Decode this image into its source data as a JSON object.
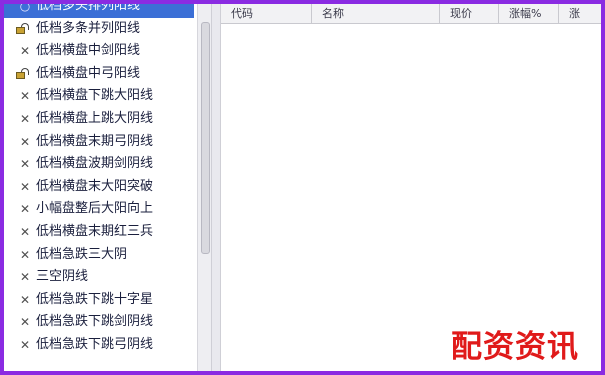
{
  "tree": {
    "items": [
      {
        "label": "低档多头排列阳线",
        "icon": "circle-icon",
        "selected": true
      },
      {
        "label": "低档多条并列阳线",
        "icon": "lock-icon"
      },
      {
        "label": "低档横盘中剑阳线",
        "icon": "x-icon"
      },
      {
        "label": "低档横盘中弓阳线",
        "icon": "lock-icon"
      },
      {
        "label": "低档横盘下跳大阳线",
        "icon": "x-icon"
      },
      {
        "label": "低档横盘上跳大阴线",
        "icon": "x-icon"
      },
      {
        "label": "低档横盘末期弓阴线",
        "icon": "x-icon"
      },
      {
        "label": "低档横盘波期剑阴线",
        "icon": "x-icon"
      },
      {
        "label": "低档横盘末大阳突破",
        "icon": "x-icon"
      },
      {
        "label": "小幅盘整后大阳向上",
        "icon": "x-icon"
      },
      {
        "label": "低档横盘末期红三兵",
        "icon": "x-icon"
      },
      {
        "label": "低档急跌三大阴",
        "icon": "x-icon"
      },
      {
        "label": "三空阴线",
        "icon": "x-icon"
      },
      {
        "label": "低档急跌下跳十字星",
        "icon": "x-icon"
      },
      {
        "label": "低档急跌下跳剑阴线",
        "icon": "x-icon"
      },
      {
        "label": "低档急跌下跳弓阴线",
        "icon": "x-icon"
      }
    ]
  },
  "grid": {
    "columns": [
      "代码",
      "名称",
      "现价",
      "涨幅%",
      "涨"
    ]
  },
  "watermark": "配资资讯",
  "colors": {
    "frame": "#8a2be2",
    "selection": "#3b6fd6",
    "watermark": "#e01a1a"
  }
}
